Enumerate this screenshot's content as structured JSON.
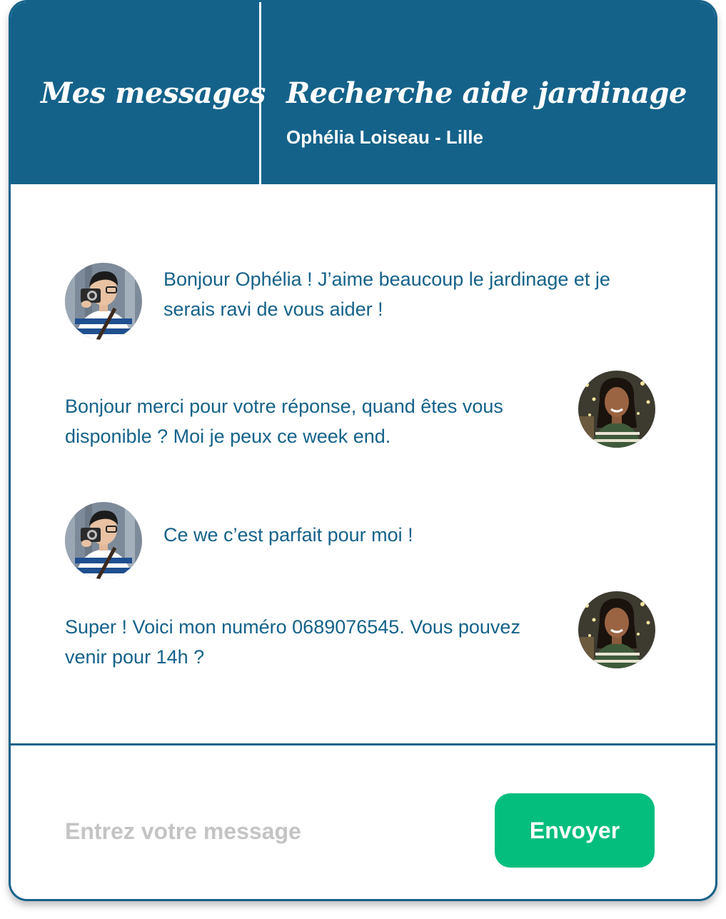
{
  "header": {
    "left_title": "Mes messages",
    "conversation_title": "Recherche aide jardinage",
    "conversation_subtitle": "Ophélia Loiseau - Lille"
  },
  "messages": [
    {
      "sender": "volunteer",
      "avatar": "man-with-camera-avatar",
      "text": "Bonjour Ophélia ! J’aime beaucoup le jardinage et je serais ravi de vous aider !"
    },
    {
      "sender": "requester",
      "avatar": "woman-smiling-avatar",
      "text": "Bonjour merci pour votre réponse, quand êtes vous disponible ? Moi je peux ce week end."
    },
    {
      "sender": "volunteer",
      "avatar": "man-with-camera-avatar",
      "text": "Ce we c’est parfait pour moi !"
    },
    {
      "sender": "requester",
      "avatar": "woman-smiling-avatar",
      "text": "Super ! Voici mon numéro 0689076545. Vous pouvez venir pour 14h ?"
    }
  ],
  "composer": {
    "placeholder": "Entrez votre message",
    "value": "",
    "send_label": "Envoyer"
  },
  "colors": {
    "primary": "#14628a",
    "send": "#04be7e",
    "placeholder": "#c4c4c4"
  }
}
